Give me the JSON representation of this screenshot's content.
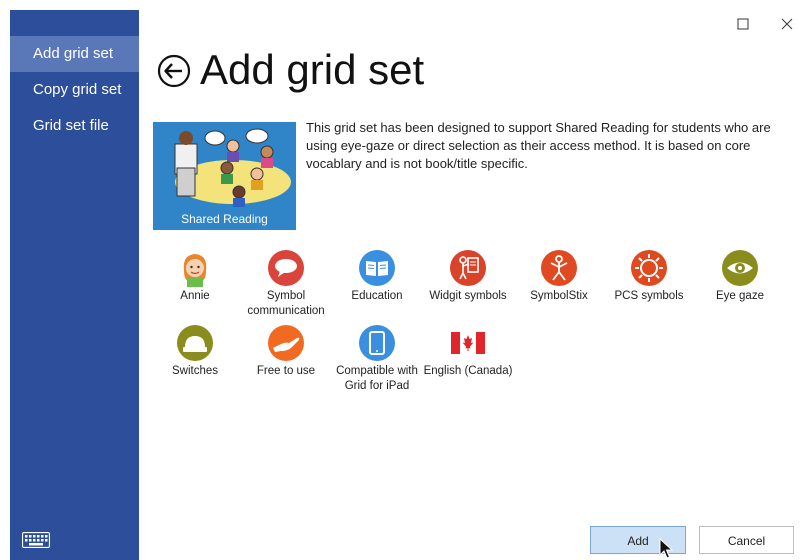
{
  "sidebar": {
    "items": [
      {
        "label": "Add grid set"
      },
      {
        "label": "Copy grid set"
      },
      {
        "label": "Grid set file"
      }
    ]
  },
  "header": {
    "title": "Add grid set"
  },
  "gridset": {
    "thumbnail_caption": "Shared Reading",
    "description": "This grid set has been designed to support Shared Reading for students who are using eye-gaze or direct selection as their access method. It is based on core vocablary and is not book/title specific."
  },
  "tags": [
    {
      "label": "Annie",
      "icon": "annie-icon"
    },
    {
      "label": "Symbol communication",
      "icon": "speech-bubble-icon",
      "color": "#d9453a"
    },
    {
      "label": "Education",
      "icon": "book-icon",
      "color": "#3b8fe0"
    },
    {
      "label": "Widgit symbols",
      "icon": "widgit-icon",
      "color": "#d8432a"
    },
    {
      "label": "SymbolStix",
      "icon": "symbolstix-icon",
      "color": "#e04a22"
    },
    {
      "label": "PCS symbols",
      "icon": "pcs-icon",
      "color": "#e0491e"
    },
    {
      "label": "Eye gaze",
      "icon": "eye-icon",
      "color": "#8a8d1d"
    },
    {
      "label": "Switches",
      "icon": "switch-icon",
      "color": "#8a8d1d"
    },
    {
      "label": "Free to use",
      "icon": "hand-icon",
      "color": "#f26a21"
    },
    {
      "label": "Compatible with Grid for iPad",
      "icon": "ipad-icon",
      "color": "#3b8fe0"
    },
    {
      "label": "English (Canada)",
      "icon": "canada-flag-icon",
      "color": "#e0252b"
    }
  ],
  "buttons": {
    "add": "Add",
    "cancel": "Cancel"
  },
  "colors": {
    "sidebar": "#2d4e9a",
    "sidebar_active": "#5a78b8",
    "add_button": "#cce0f6"
  }
}
